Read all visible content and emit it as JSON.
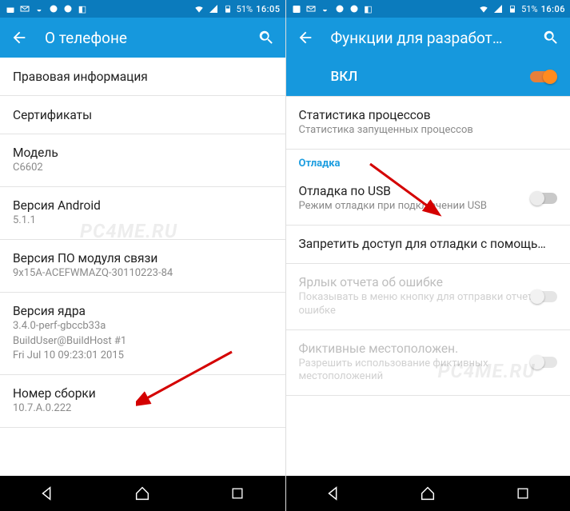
{
  "left": {
    "statusbar": {
      "battery": "51%",
      "time": "16:05"
    },
    "appbar": {
      "title": "О телефоне"
    },
    "rows": {
      "legal": "Правовая информация",
      "certs": "Сертификаты",
      "model_label": "Модель",
      "model_value": "C6602",
      "android_label": "Версия Android",
      "android_value": "5.1.1",
      "baseband_label": "Версия ПО модуля связи",
      "baseband_value": "9x15A-ACEFWMAZQ-30110223-84",
      "kernel_label": "Версия ядра",
      "kernel_line1": "3.4.0-perf-gbccb33a",
      "kernel_line2": "BuildUser@BuildHost #1",
      "kernel_line3": "Fri Jul 10 09:23:01 2015",
      "build_label": "Номер сборки",
      "build_value": "10.7.A.0.222"
    }
  },
  "right": {
    "statusbar": {
      "battery": "51%",
      "time": "16:06"
    },
    "appbar": {
      "title": "Функции для разработ…"
    },
    "master": "ВКЛ",
    "rows": {
      "procstats_label": "Статистика процессов",
      "procstats_value": "Статистика запущенных процессов",
      "section_debug": "Отладка",
      "usb_label": "Отладка по USB",
      "usb_value": "Режим отладки при подключении USB",
      "revoke": "Запретить доступ для отладки с помощь…",
      "bugreport_label": "Ярлык отчета об ошибке",
      "bugreport_value": "Показывать в меню кнопку для отправки отчета об ошибке",
      "mock_label": "Фиктивные местоположен.",
      "mock_value": "Разрешить использование фиктивных местоположений"
    }
  },
  "watermark": "PC4ME.RU"
}
